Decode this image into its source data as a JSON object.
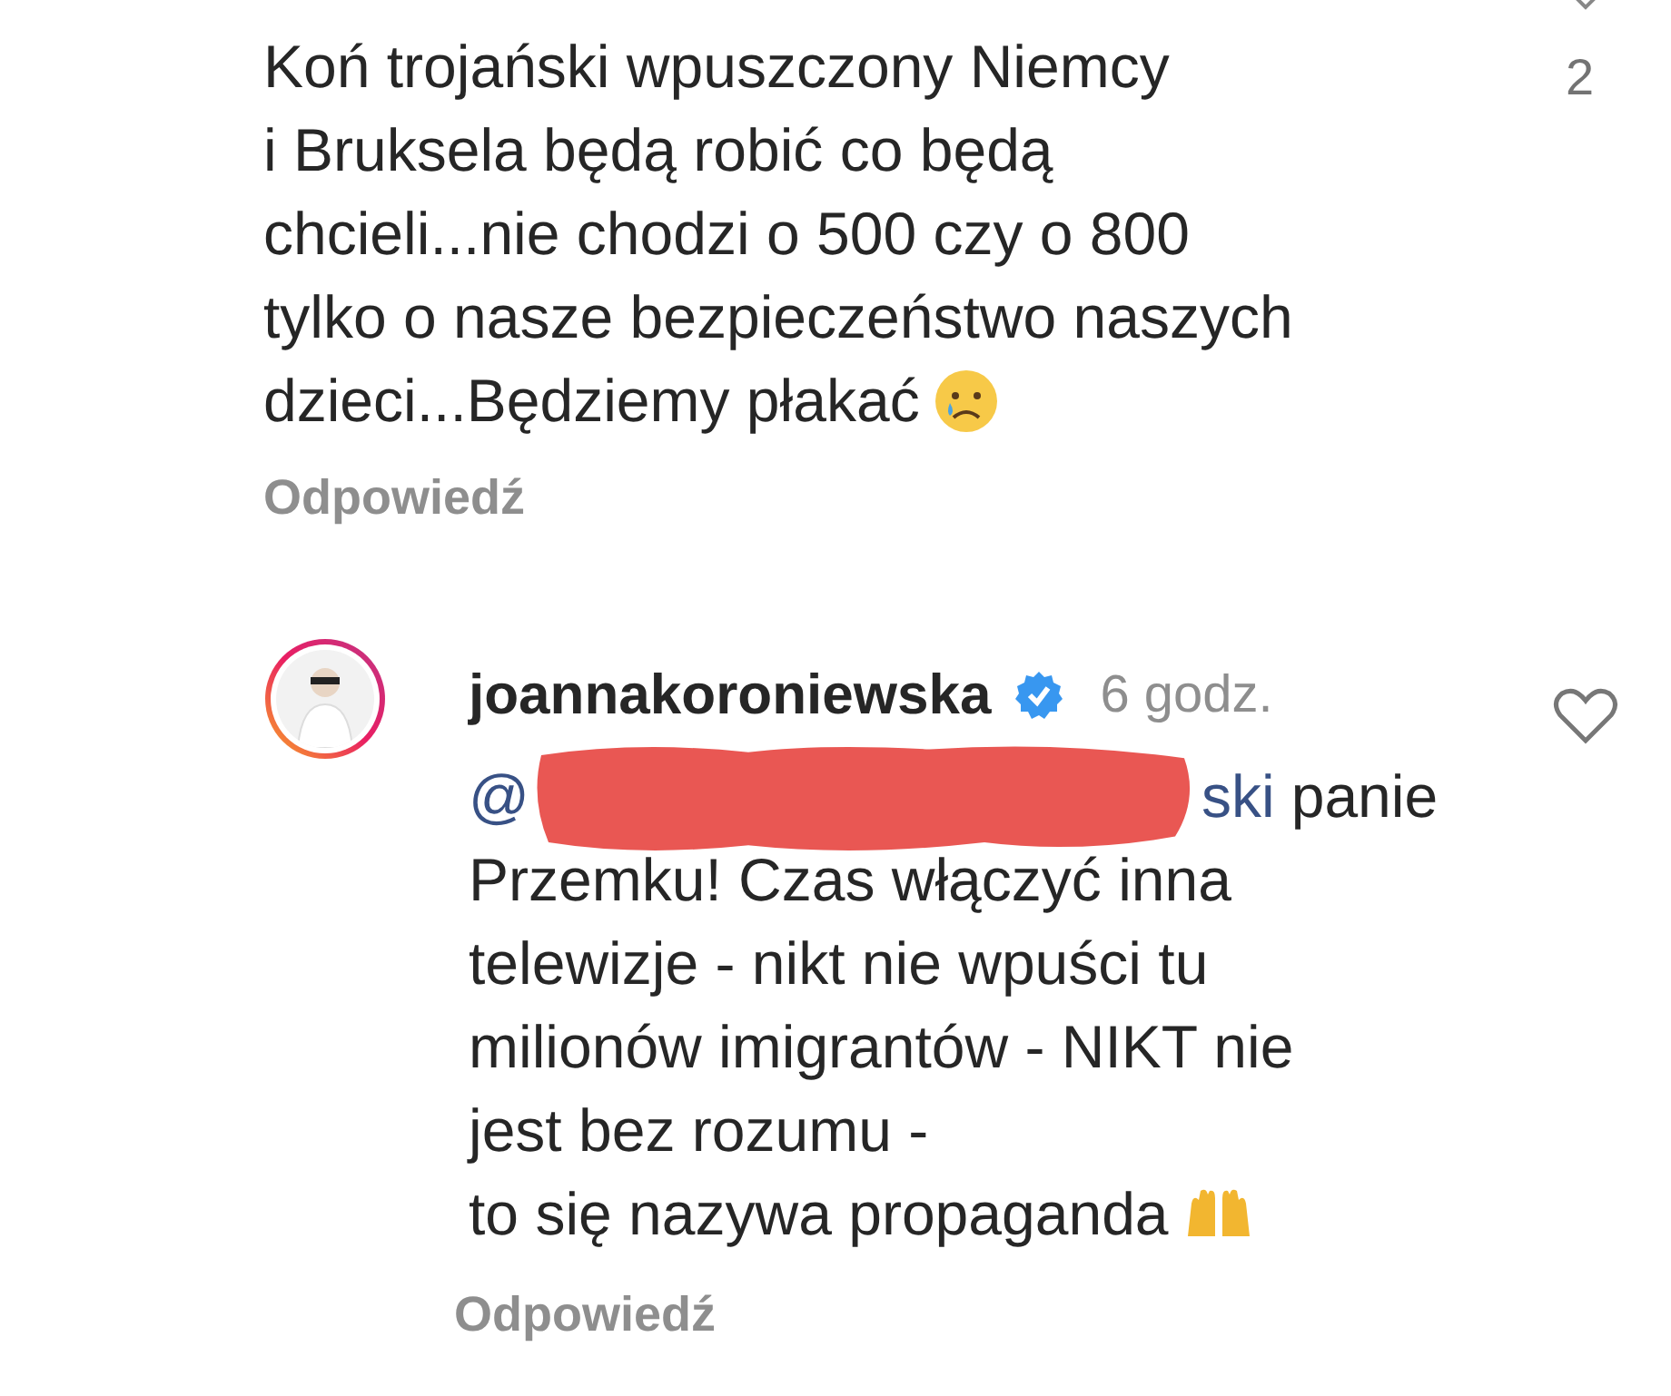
{
  "comments": [
    {
      "kind": "plain",
      "lines": [
        "Koń trojański wpuszczony Niemcy",
        "i Bruksela będą robić co będą",
        "chcieli...nie chodzi o 500 czy o 800",
        "tylko o nasze bezpieczeństwo naszych",
        "dzieci...Będziemy płakać"
      ],
      "like_count": "2",
      "reply": "Odpowiedź"
    },
    {
      "kind": "reply",
      "username": "joannakoroniewska",
      "verified": true,
      "time": "6 godz.",
      "mention_start": "@",
      "mention_end": "ski",
      "first_line": "panie",
      "lines": [
        "Przemku! Czas włączyć inna",
        "telewizje - nikt nie wpuści tu",
        "milionów imigrantów - NIKT nie",
        "jest bez rozumu -",
        "to się nazywa propaganda"
      ],
      "reply": "Odpowiedź"
    }
  ]
}
